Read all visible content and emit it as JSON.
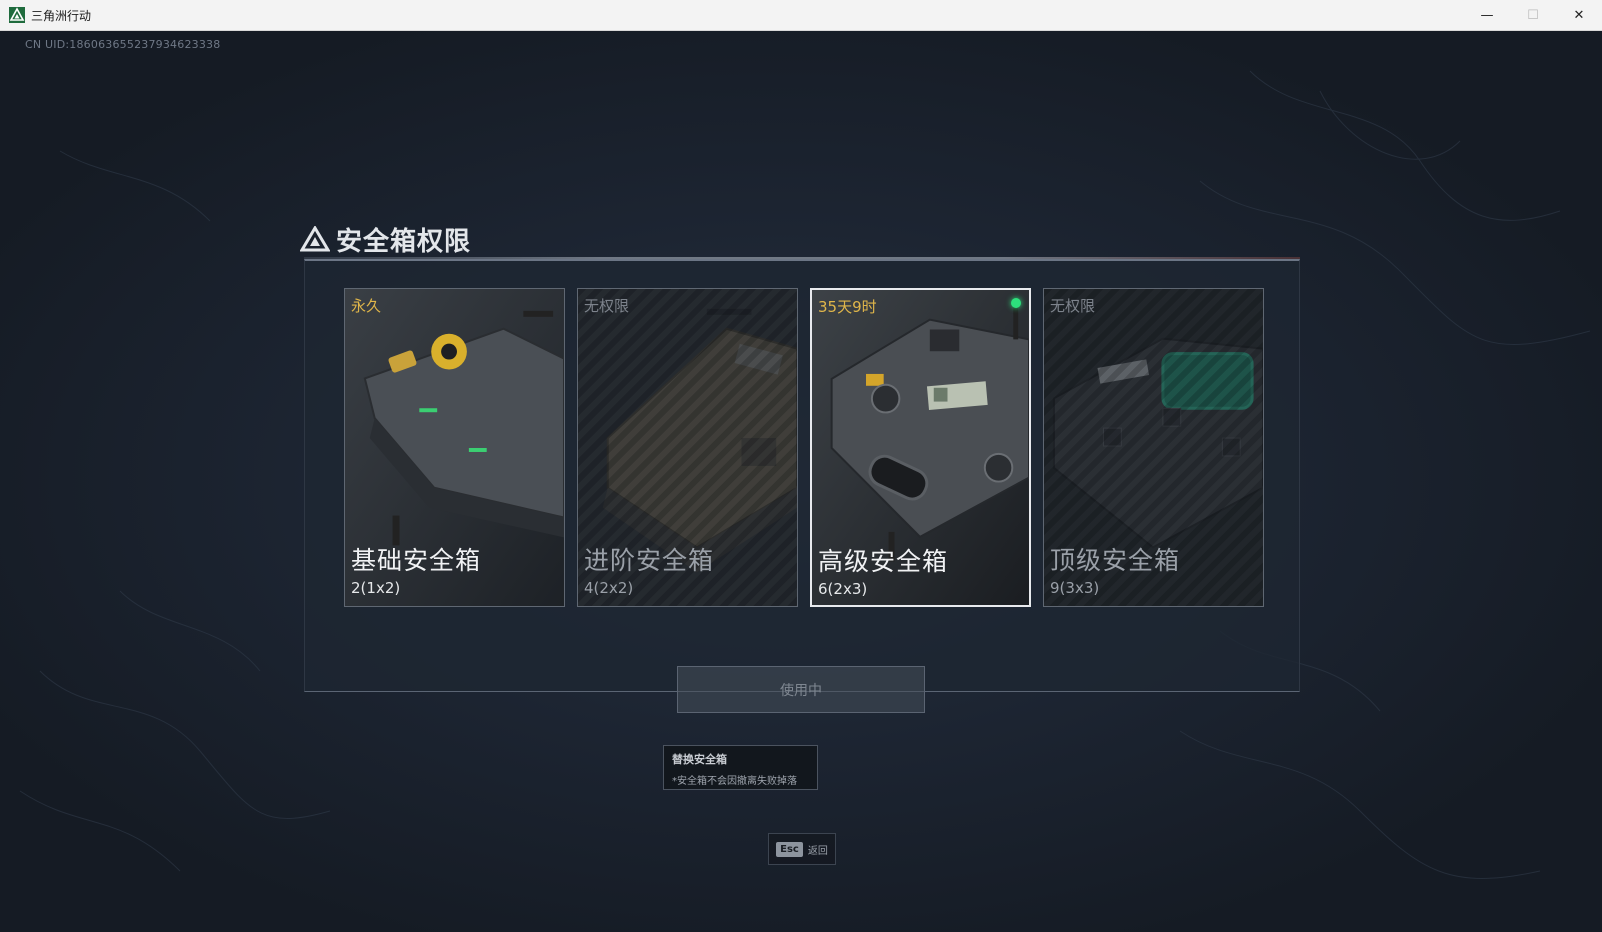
{
  "window": {
    "title": "三角洲行动",
    "icon": "delta-logo-icon",
    "controls": {
      "minimize": "—",
      "maximize": "☐",
      "close": "✕"
    }
  },
  "uid": "CN UID:186063655237934623338",
  "panel": {
    "title": "安全箱权限",
    "cards": [
      {
        "status": "永久",
        "name": "基础安全箱",
        "capacity": "2(1x2)",
        "locked": false,
        "selected": false
      },
      {
        "status": "无权限",
        "name": "进阶安全箱",
        "capacity": "4(2x2)",
        "locked": true,
        "selected": false
      },
      {
        "status": "35天9时",
        "name": "高级安全箱",
        "capacity": "6(2x3)",
        "locked": false,
        "selected": true
      },
      {
        "status": "无权限",
        "name": "顶级安全箱",
        "capacity": "9(3x3)",
        "locked": true,
        "selected": false
      }
    ],
    "use_button": "使用中"
  },
  "info": {
    "title": "替换安全箱",
    "note": "*安全箱不会因撤离失败掉落"
  },
  "esc": {
    "key": "Esc",
    "label": "返回"
  },
  "colors": {
    "gold": "#e0b64a",
    "active": "#2de07c"
  }
}
